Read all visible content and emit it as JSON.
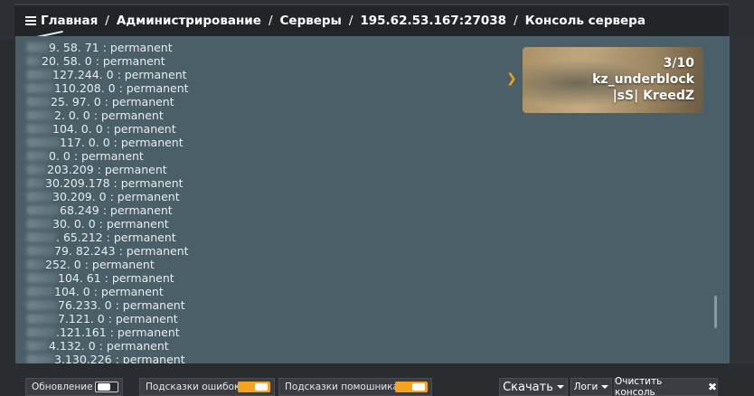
{
  "breadcrumb": {
    "items": [
      "Главная",
      "Администрирование",
      "Серверы",
      "195.62.53.167:27038",
      "Консоль сервера"
    ],
    "separator": "/"
  },
  "console": {
    "lines": [
      {
        "visible": "9. 58. 71 : permanent"
      },
      {
        "visible": "20. 58. 0 : permanent"
      },
      {
        "visible": "127.244. 0 : permanent"
      },
      {
        "visible": "110.208. 0 : permanent"
      },
      {
        "visible": "25. 97. 0 : permanent"
      },
      {
        "visible": "2. 0. 0 : permanent"
      },
      {
        "visible": "104. 0. 0 : permanent"
      },
      {
        "visible": "117. 0. 0 : permanent"
      },
      {
        "visible": "0. 0 : permanent"
      },
      {
        "visible": "203.209 : permanent"
      },
      {
        "visible": "30.209.178 : permanent"
      },
      {
        "visible": "30.209. 0 : permanent"
      },
      {
        "visible": "68.249 : permanent"
      },
      {
        "visible": "30. 0. 0 : permanent"
      },
      {
        "visible": ". 65.212 : permanent"
      },
      {
        "visible": "79. 82.243 : permanent"
      },
      {
        "visible": "252. 0 : permanent"
      },
      {
        "visible": "104. 61 : permanent"
      },
      {
        "visible": "104. 0 : permanent"
      },
      {
        "visible": "76.233. 0 : permanent"
      },
      {
        "visible": "7.121. 0 : permanent"
      },
      {
        "visible": ".121.161 : permanent"
      },
      {
        "visible": "4.132. 0 : permanent"
      },
      {
        "visible": "3.130.226 : permanent"
      }
    ]
  },
  "map_card": {
    "count": "3/10",
    "map_name": "kz_underblock",
    "server_name": "|sS| KreedZ"
  },
  "toolbar": {
    "refresh_label": "Обновление",
    "refresh_on": false,
    "error_hints_label": "Подсказки ошибок",
    "error_hints_on": true,
    "helper_hints_label": "Подсказки помошника",
    "helper_hints_on": true,
    "download_label": "Скачать",
    "logs_label": "Логи",
    "clear_label": "Очистить консоль"
  },
  "colors": {
    "accent": "#f5a321",
    "console_bg": "#4b5f69",
    "bar_bg": "#222528"
  }
}
